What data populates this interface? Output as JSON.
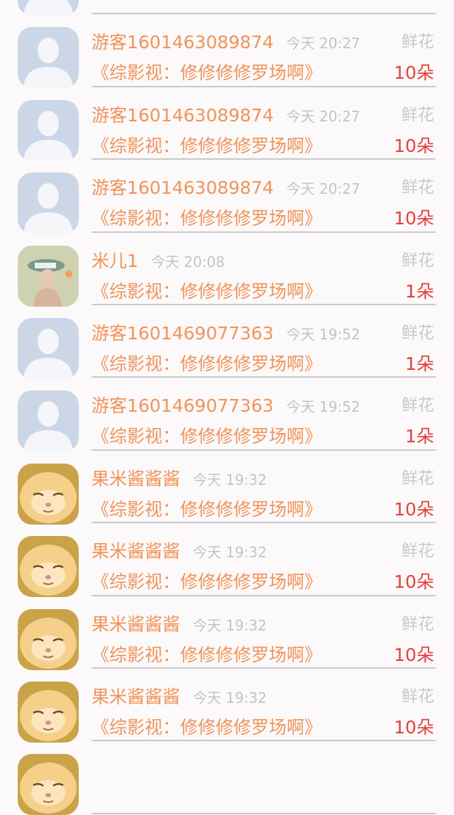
{
  "gift_list": {
    "items": [
      {
        "avatar": "default",
        "name": "",
        "time": "",
        "gift": "",
        "program": "",
        "count": ""
      },
      {
        "avatar": "default",
        "name": "游客1601463089874",
        "time": "今天 20:27",
        "gift": "鲜花",
        "program": "《综影视：修修修修罗场啊》",
        "count": "10朵"
      },
      {
        "avatar": "default",
        "name": "游客1601463089874",
        "time": "今天 20:27",
        "gift": "鲜花",
        "program": "《综影视：修修修修罗场啊》",
        "count": "10朵"
      },
      {
        "avatar": "default",
        "name": "游客1601463089874",
        "time": "今天 20:27",
        "gift": "鲜花",
        "program": "《综影视：修修修修罗场啊》",
        "count": "10朵"
      },
      {
        "avatar": "painting",
        "name": "米儿1",
        "time": "今天 20:08",
        "gift": "鲜花",
        "program": "《综影视：修修修修罗场啊》",
        "count": "1朵"
      },
      {
        "avatar": "default",
        "name": "游客1601469077363",
        "time": "今天 19:52",
        "gift": "鲜花",
        "program": "《综影视：修修修修罗场啊》",
        "count": "1朵"
      },
      {
        "avatar": "default",
        "name": "游客1601469077363",
        "time": "今天 19:52",
        "gift": "鲜花",
        "program": "《综影视：修修修修罗场啊》",
        "count": "1朵"
      },
      {
        "avatar": "kitten",
        "name": "果米酱酱酱",
        "time": "今天 19:32",
        "gift": "鲜花",
        "program": "《综影视：修修修修罗场啊》",
        "count": "10朵"
      },
      {
        "avatar": "kitten",
        "name": "果米酱酱酱",
        "time": "今天 19:32",
        "gift": "鲜花",
        "program": "《综影视：修修修修罗场啊》",
        "count": "10朵"
      },
      {
        "avatar": "kitten",
        "name": "果米酱酱酱",
        "time": "今天 19:32",
        "gift": "鲜花",
        "program": "《综影视：修修修修罗场啊》",
        "count": "10朵"
      },
      {
        "avatar": "kitten",
        "name": "果米酱酱酱",
        "time": "今天 19:32",
        "gift": "鲜花",
        "program": "《综影视：修修修修罗场啊》",
        "count": "10朵"
      },
      {
        "avatar": "kitten",
        "name": "",
        "time": "",
        "gift": "",
        "program": "",
        "count": ""
      }
    ]
  },
  "colors": {
    "accent_orange": "#f0945a",
    "count_red": "#e5403a",
    "muted_gray": "#c4c4c4",
    "background": "#fbf9fa"
  }
}
